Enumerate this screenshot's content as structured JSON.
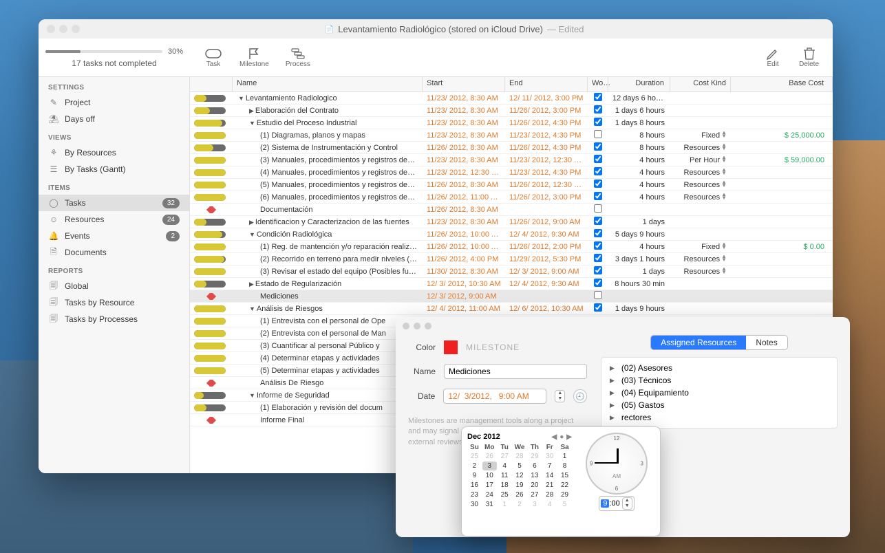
{
  "titlebar": {
    "title": "Levantamiento Radiológico (stored on iCloud Drive)",
    "edited": "— Edited"
  },
  "progress": {
    "percent": "30%",
    "subtitle": "17 tasks not completed"
  },
  "toolbar": {
    "task": "Task",
    "milestone": "Milestone",
    "process": "Process",
    "edit": "Edit",
    "delete": "Delete"
  },
  "sidebar": {
    "sections": {
      "settings": "SETTINGS",
      "views": "VIEWS",
      "items": "ITEMS",
      "reports": "REPORTS"
    },
    "settings": [
      "Project",
      "Days off"
    ],
    "views": [
      "By Resources",
      "By Tasks (Gantt)"
    ],
    "items": {
      "tasks": {
        "label": "Tasks",
        "badge": "32"
      },
      "resources": {
        "label": "Resources",
        "badge": "24"
      },
      "events": {
        "label": "Events",
        "badge": "2"
      },
      "documents": {
        "label": "Documents"
      }
    },
    "reports": [
      "Global",
      "Tasks by Resource",
      "Tasks by Processes"
    ]
  },
  "grid": {
    "headers": {
      "name": "Name",
      "start": "Start",
      "end": "End",
      "wo": "Wo…",
      "duration": "Duration",
      "costkind": "Cost Kind",
      "basecost": "Base Cost"
    },
    "rows": [
      {
        "type": "group",
        "level": 0,
        "name": "Levantamiento Radiologico",
        "start": "11/23/ 2012,   8:30 AM",
        "end": "12/ 11/ 2012,   3:00 PM",
        "wo": true,
        "dur": "12 days 6 hours",
        "pf": 40
      },
      {
        "type": "group",
        "level": 1,
        "name": "Elaboración del Contrato",
        "start": "11/23/ 2012,   8:30 AM",
        "end": "11/26/ 2012,   3:00 PM",
        "wo": true,
        "dur": "1 days 6 hours",
        "pf": 50,
        "tri": "closed"
      },
      {
        "type": "group",
        "level": 1,
        "name": "Estudio del Proceso Industrial",
        "start": "11/23/ 2012,   8:30 AM",
        "end": "11/26/ 2012,   4:30 PM",
        "wo": true,
        "dur": "1 days 8 hours",
        "pf": 90
      },
      {
        "type": "task",
        "level": 2,
        "name": "(1) Diagramas, planos y mapas",
        "start": "11/23/ 2012,   8:30 AM",
        "end": "11/23/ 2012,   4:30 PM",
        "wo": false,
        "dur": "8 hours",
        "ck": "Fixed",
        "bc": "$ 25,000.00",
        "pf": 100
      },
      {
        "type": "task",
        "level": 2,
        "name": "(2) Sistema de Instrumentación y Control",
        "start": "11/26/ 2012,   8:30 AM",
        "end": "11/26/ 2012,   4:30 PM",
        "wo": true,
        "dur": "8 hours",
        "ck": "Resources",
        "pf": 60
      },
      {
        "type": "task",
        "level": 2,
        "name": "(3) Manuales, procedimientos y registros de…",
        "start": "11/23/ 2012,   8:30 AM",
        "end": "11/23/ 2012, 12:30 PM",
        "wo": true,
        "dur": "4 hours",
        "ck": "Per Hour",
        "bc": "$ 59,000.00",
        "pf": 100
      },
      {
        "type": "task",
        "level": 2,
        "name": "(4) Manuales, procedimientos y registros de…",
        "start": "11/23/ 2012, 12:30 PM",
        "end": "11/23/ 2012,   4:30 PM",
        "wo": true,
        "dur": "4 hours",
        "ck": "Resources",
        "pf": 100
      },
      {
        "type": "task",
        "level": 2,
        "name": "(5) Manuales, procedimientos y registros de…",
        "start": "11/26/ 2012,   8:30 AM",
        "end": "11/26/ 2012, 12:30 PM",
        "wo": true,
        "dur": "4 hours",
        "ck": "Resources",
        "pf": 100
      },
      {
        "type": "task",
        "level": 2,
        "name": "(6) Manuales, procedimientos y registros de…",
        "start": "11/26/ 2012, 11:00 AM",
        "end": "11/26/ 2012,   3:00 PM",
        "wo": true,
        "dur": "4 hours",
        "ck": "Resources",
        "pf": 100
      },
      {
        "type": "milestone",
        "level": 2,
        "name": "Documentación",
        "start": "11/26/ 2012,   8:30 AM",
        "end": "",
        "wo": false,
        "dur": ""
      },
      {
        "type": "group",
        "level": 1,
        "name": "Identificacion y Caracterizacion de las fuentes",
        "start": "11/23/ 2012,   8:30 AM",
        "end": "11/26/ 2012,   9:00 AM",
        "wo": true,
        "dur": "1 days",
        "pf": 40,
        "tri": "closed"
      },
      {
        "type": "group",
        "level": 1,
        "name": "Condición Radiológica",
        "start": "11/26/ 2012, 10:00 AM",
        "end": "12/  4/ 2012,   9:30 AM",
        "wo": true,
        "dur": "5 days 9 hours",
        "pf": 90
      },
      {
        "type": "task",
        "level": 2,
        "name": "(1) Reg. de mantención y/o reparación realiz…",
        "start": "11/26/ 2012, 10:00 AM",
        "end": "11/26/ 2012,   2:00 PM",
        "wo": true,
        "dur": "4 hours",
        "ck": "Fixed",
        "bc": "$ 0.00",
        "pf": 100
      },
      {
        "type": "task",
        "level": 2,
        "name": "(2) Recorrido en terreno para medir niveles (…",
        "start": "11/26/ 2012,   4:00 PM",
        "end": "11/29/ 2012,   5:30 PM",
        "wo": true,
        "dur": "3 days 1 hours",
        "ck": "Resources",
        "pf": 95
      },
      {
        "type": "task",
        "level": 2,
        "name": "(3) Revisar el estado del equipo (Posibles fu…",
        "start": "11/30/ 2012,   8:30 AM",
        "end": "12/  3/ 2012,   9:00 AM",
        "wo": true,
        "dur": "1 days",
        "ck": "Resources",
        "pf": 100
      },
      {
        "type": "group",
        "level": 1,
        "name": "Estado de Regularización",
        "start": "12/  3/ 2012, 10:30 AM",
        "end": "12/  4/ 2012,   9:30 AM",
        "wo": true,
        "dur": "8 hours 30 min",
        "pf": 40,
        "tri": "closed"
      },
      {
        "type": "milestone",
        "level": 2,
        "name": "Mediciones",
        "start": "12/  3/ 2012,   9:00 AM",
        "end": "",
        "wo": false,
        "dur": "",
        "sel": true
      },
      {
        "type": "group",
        "level": 1,
        "name": "Análisis de Riesgos",
        "start": "12/  4/ 2012, 11:00 AM",
        "end": "12/  6/ 2012, 10:30 AM",
        "wo": true,
        "dur": "1 days 9 hours",
        "pf": 100
      },
      {
        "type": "task",
        "level": 2,
        "name": "(1) Entrevista con el personal de Ope",
        "pf": 100
      },
      {
        "type": "task",
        "level": 2,
        "name": "(2) Entrevista con el personal de Man",
        "pf": 100
      },
      {
        "type": "task",
        "level": 2,
        "name": "(3) Cuantificar al personal Público y",
        "pf": 100
      },
      {
        "type": "task",
        "level": 2,
        "name": "(4) Determinar etapas y actividades",
        "pf": 100
      },
      {
        "type": "task",
        "level": 2,
        "name": "(5) Determinar etapas y actividades",
        "pf": 100
      },
      {
        "type": "milestone",
        "level": 2,
        "name": "Análisis De Riesgo"
      },
      {
        "type": "group",
        "level": 1,
        "name": "Informe de Seguridad",
        "pf": 30
      },
      {
        "type": "task",
        "level": 2,
        "name": "(1) Elaboración y revisión del docum",
        "pf": 40
      },
      {
        "type": "milestone",
        "level": 2,
        "name": "Informe Final"
      }
    ]
  },
  "popover": {
    "labels": {
      "color": "Color",
      "name": "Name",
      "date": "Date",
      "milestone": "MILESTONE"
    },
    "name_value": "Mediciones",
    "date_value": "12/  3/2012,   9:00 AM",
    "hint": "Milestones are management tools along a project and may signal an important start and end, or external reviews or checks.",
    "tabs": {
      "assigned": "Assigned Resources",
      "notes": "Notes"
    },
    "resources": [
      "(02) Asesores",
      "(03) Técnicos",
      "(04) Equipamiento",
      "(05) Gastos",
      "rectores"
    ]
  },
  "datepicker": {
    "month": "Dec 2012",
    "dow": [
      "Su",
      "Mo",
      "Tu",
      "We",
      "Th",
      "Fr",
      "Sa"
    ],
    "prev_tail": [
      "25",
      "26",
      "27",
      "28",
      "29",
      "30",
      "1"
    ],
    "rows": [
      [
        "2",
        "3",
        "4",
        "5",
        "6",
        "7",
        "8"
      ],
      [
        "9",
        "10",
        "11",
        "12",
        "13",
        "14",
        "15"
      ],
      [
        "16",
        "17",
        "18",
        "19",
        "20",
        "21",
        "22"
      ],
      [
        "23",
        "24",
        "25",
        "26",
        "27",
        "28",
        "29"
      ],
      [
        "30",
        "31",
        "1",
        "2",
        "3",
        "4",
        "5"
      ]
    ],
    "selected": "3",
    "am": "AM",
    "time_h": "9",
    "time_m": ":00"
  }
}
